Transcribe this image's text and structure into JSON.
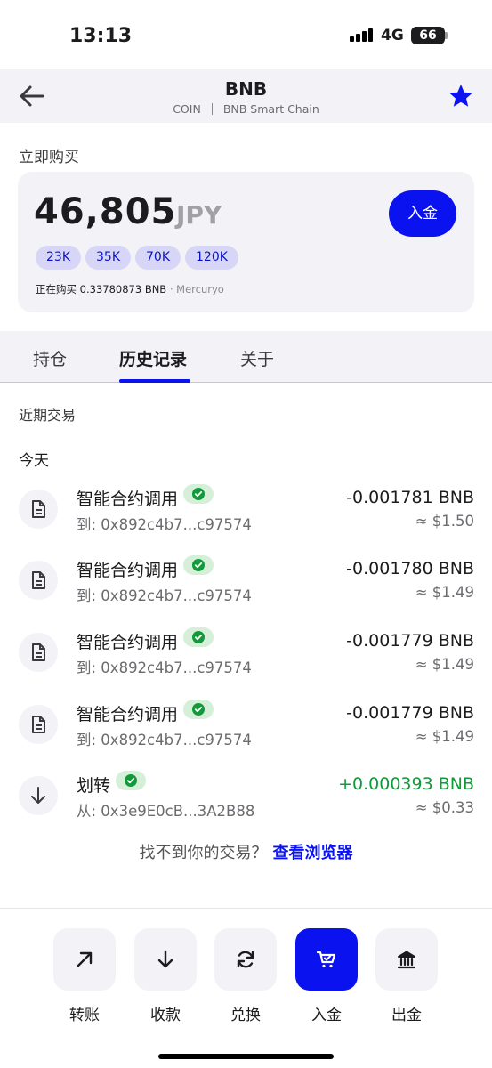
{
  "status": {
    "time": "13:13",
    "network": "4G",
    "battery": "66"
  },
  "header": {
    "title": "BNB",
    "type": "COIN",
    "chain": "BNB Smart Chain"
  },
  "buy": {
    "label": "立即购买",
    "amount": "46,805",
    "currency": "JPY",
    "deposit_label": "入金",
    "chips": [
      "23K",
      "35K",
      "70K",
      "120K"
    ],
    "note": "正在购买 0.33780873 BNB",
    "provider": " · Mercuryo"
  },
  "tabs": [
    {
      "label": "持仓"
    },
    {
      "label": "历史记录"
    },
    {
      "label": "关于"
    }
  ],
  "recent_label": "近期交易",
  "today_label": "今天",
  "transactions": [
    {
      "icon": "document-icon",
      "title": "智能合约调用",
      "address": "到: 0x892c4b7...c97574",
      "amount": "-0.001781 BNB",
      "fiat": "≈ $1.50",
      "positive": false
    },
    {
      "icon": "document-icon",
      "title": "智能合约调用",
      "address": "到: 0x892c4b7...c97574",
      "amount": "-0.001780 BNB",
      "fiat": "≈ $1.49",
      "positive": false
    },
    {
      "icon": "document-icon",
      "title": "智能合约调用",
      "address": "到: 0x892c4b7...c97574",
      "amount": "-0.001779 BNB",
      "fiat": "≈ $1.49",
      "positive": false
    },
    {
      "icon": "document-icon",
      "title": "智能合约调用",
      "address": "到: 0x892c4b7...c97574",
      "amount": "-0.001779 BNB",
      "fiat": "≈ $1.49",
      "positive": false
    },
    {
      "icon": "arrow-down-icon",
      "title": "划转",
      "address": "从: 0x3e9E0cB...3A2B88",
      "amount": "+0.000393 BNB",
      "fiat": "≈ $0.33",
      "positive": true
    }
  ],
  "footer": {
    "question": "找不到你的交易？",
    "link": "查看浏览器"
  },
  "actions": [
    {
      "label": "转账",
      "icon": "arrow-up-right-icon"
    },
    {
      "label": "收款",
      "icon": "arrow-down-icon"
    },
    {
      "label": "兑换",
      "icon": "swap-icon"
    },
    {
      "label": "入金",
      "icon": "cart-icon"
    },
    {
      "label": "出金",
      "icon": "bank-icon"
    }
  ],
  "colors": {
    "accent": "#0a12f0",
    "positive": "#109a3a",
    "chip_bg": "#d8d6f7",
    "surface": "#f2f2f7"
  }
}
